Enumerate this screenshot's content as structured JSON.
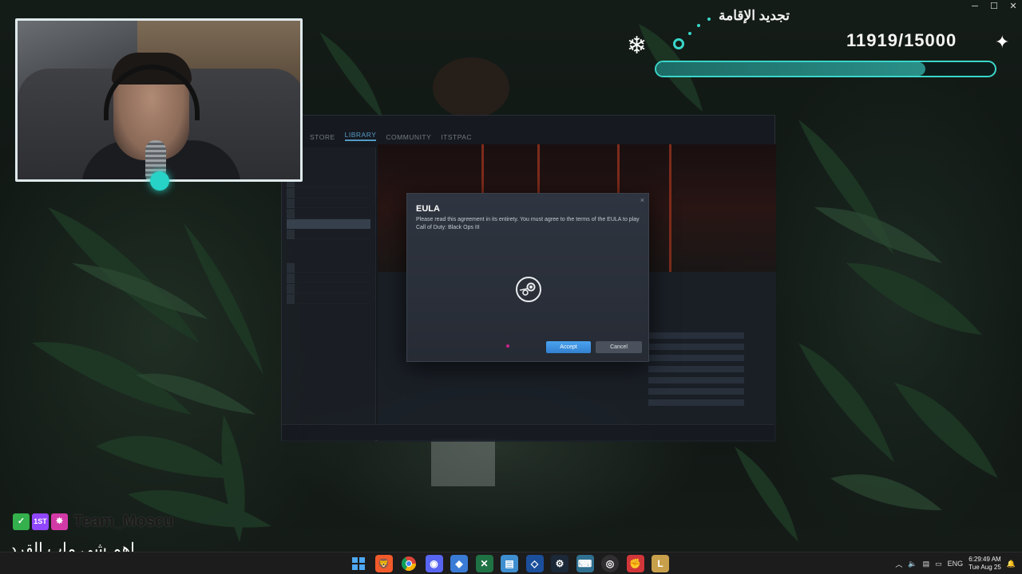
{
  "window_controls": {
    "minimize": "─",
    "maximize": "☐",
    "close": "✕"
  },
  "goal": {
    "title": "تجديد الإقامة",
    "count": "11919/15000",
    "progress": 0.7946,
    "accent_color": "#39d6c9"
  },
  "steam": {
    "nav": [
      "STORE",
      "LIBRARY",
      "COMMUNITY",
      "ITSTPAC"
    ],
    "active_nav": "LIBRARY"
  },
  "dialog": {
    "title": "EULA",
    "text": "Please read this agreement in its entirety. You must agree to the terms of the EULA to play Call of Duty: Black Ops III",
    "close": "×",
    "accept": "Accept",
    "cancel": "Cancel",
    "accept_color": "#3b8fe0"
  },
  "chat": {
    "badges": [
      "✓",
      "1ST",
      "✸"
    ],
    "username": "Team_Moscu",
    "message": "اهم شي ماب القرد"
  },
  "taskbar": {
    "icons": [
      "windows-icon",
      "brave-icon",
      "chrome-icon",
      "discord-icon",
      "files-icon",
      "excel-icon",
      "notepad-icon",
      "azure-icon",
      "steam-icon",
      "keyboard-icon",
      "obs-icon",
      "riot-icon",
      "league-icon"
    ],
    "tray": {
      "language": "ENG",
      "time": "6:29:49 AM",
      "date": "Tue Aug 25"
    }
  }
}
